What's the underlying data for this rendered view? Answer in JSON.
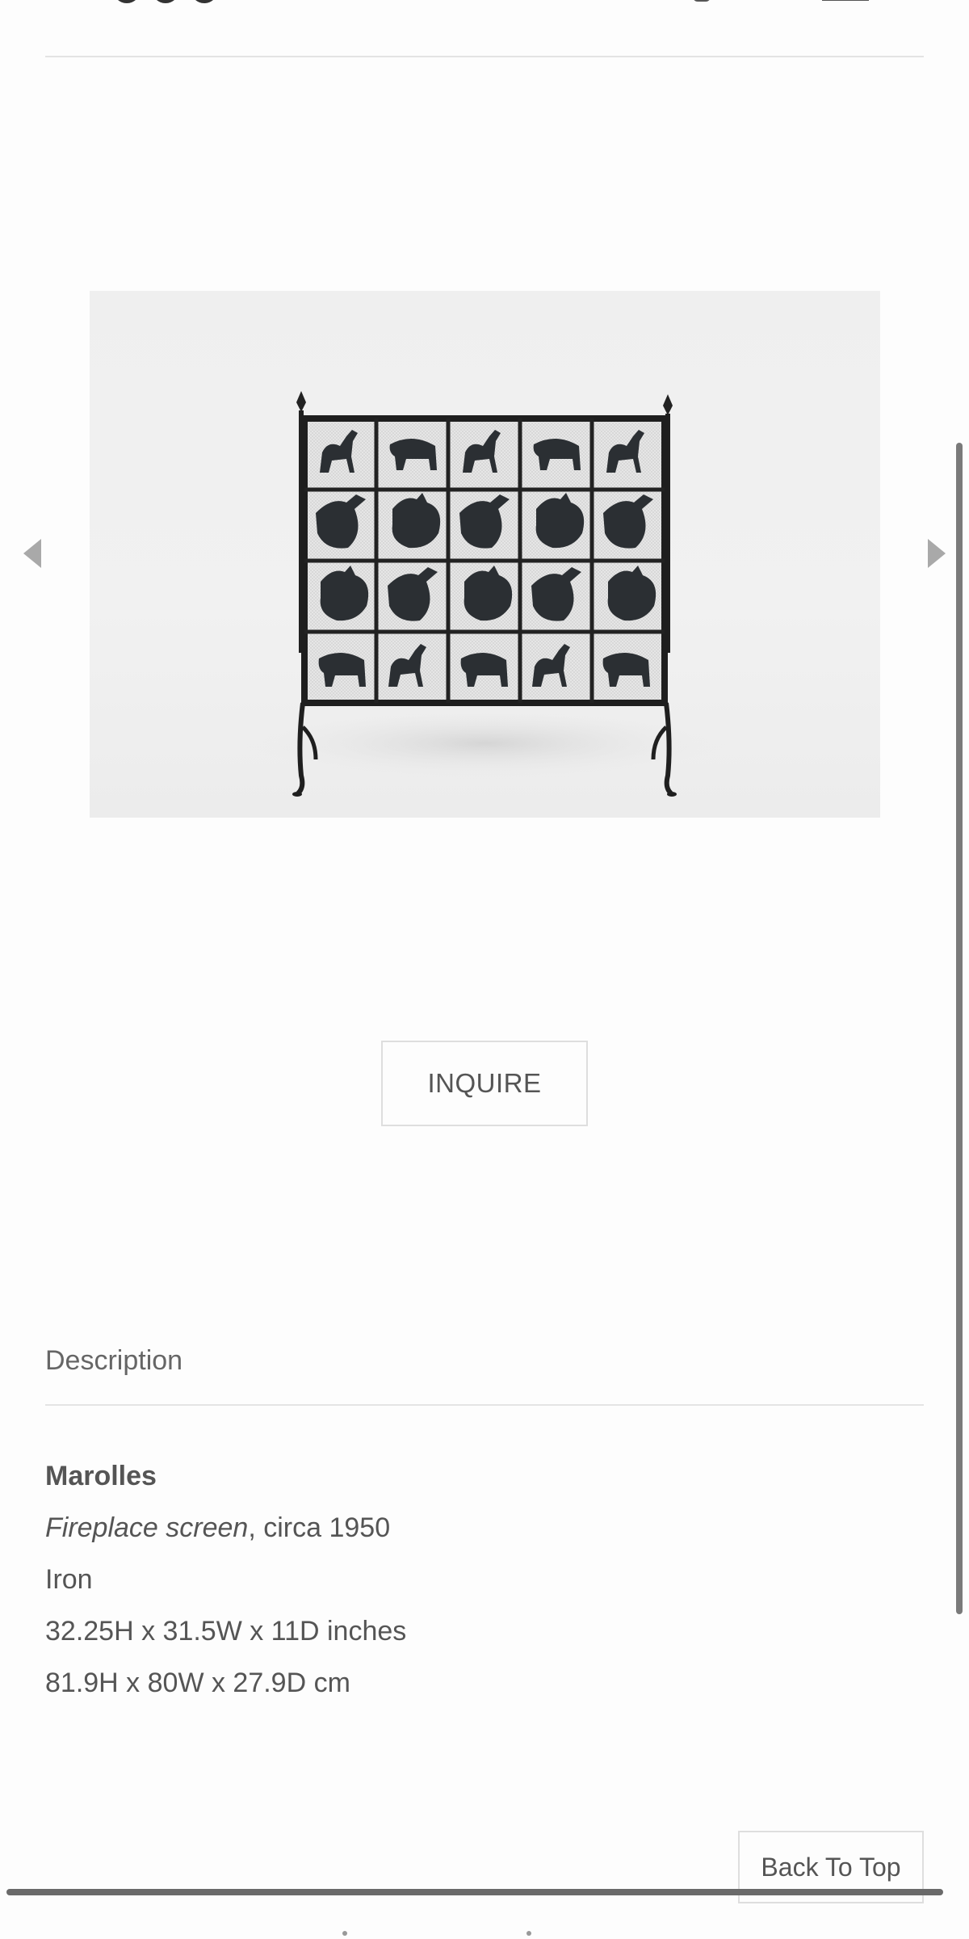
{
  "carousel": {
    "prev_icon": "chevron-left-icon",
    "next_icon": "chevron-right-icon",
    "image_alt": "Fireplace screen"
  },
  "inquire": {
    "label": "INQUIRE"
  },
  "description": {
    "heading": "Description",
    "artist": "Marolles",
    "title": "Fireplace screen",
    "date": ", circa 1950",
    "material": "Iron",
    "dimensions_in": "32.25H x 31.5W x 11D inches",
    "dimensions_cm": "81.9H x 80W x 27.9D cm"
  },
  "back_to_top": {
    "label": "Back To Top"
  },
  "colors": {
    "text": "#555555",
    "divider": "#e4e4e4",
    "background": "#fdfdfd"
  }
}
